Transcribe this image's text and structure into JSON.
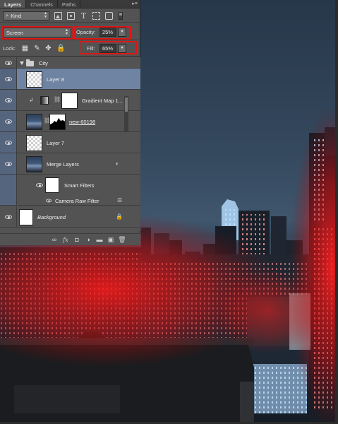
{
  "panel": {
    "tabs": [
      {
        "label": "Layers",
        "active": true
      },
      {
        "label": "Channels",
        "active": false
      },
      {
        "label": "Paths",
        "active": false
      }
    ],
    "menu_icon": "panel-menu-icon",
    "filter": {
      "kind_label": "Kind",
      "icons": [
        "pixel-filter-icon",
        "adjustment-filter-icon",
        "type-filter-icon",
        "shape-filter-icon",
        "smart-object-filter-icon"
      ]
    },
    "blend_mode": "Screen",
    "opacity_label": "Opacity:",
    "opacity_value": "25%",
    "lock_label": "Lock:",
    "fill_label": "Fill:",
    "fill_value": "65%"
  },
  "layers": [
    {
      "name": "City",
      "type": "group",
      "expanded": true
    },
    {
      "name": "Layer 8",
      "type": "pixel",
      "selected": true
    },
    {
      "name": "Gradient Map 1...",
      "type": "adjustment",
      "clipped": true
    },
    {
      "name": "new-60198",
      "type": "masked-pixel"
    },
    {
      "name": "Layer 7",
      "type": "pixel"
    },
    {
      "name": "Merge Layers",
      "type": "smart-object"
    },
    {
      "name": "Smart Filters",
      "type": "smart-filters"
    },
    {
      "name": "Camera Raw Filter",
      "type": "filter"
    },
    {
      "name": "Background",
      "type": "background",
      "locked": true
    }
  ],
  "bottom_bar_icons": [
    "link-icon",
    "fx-icon",
    "mask-icon",
    "adjustment-icon",
    "folder-icon",
    "new-layer-icon",
    "trash-icon"
  ],
  "colors": {
    "panel_bg": "#535353",
    "selected_layer": "#6f83a3",
    "highlight_box": "#e01515",
    "red_glow": "#ff1a1a"
  }
}
